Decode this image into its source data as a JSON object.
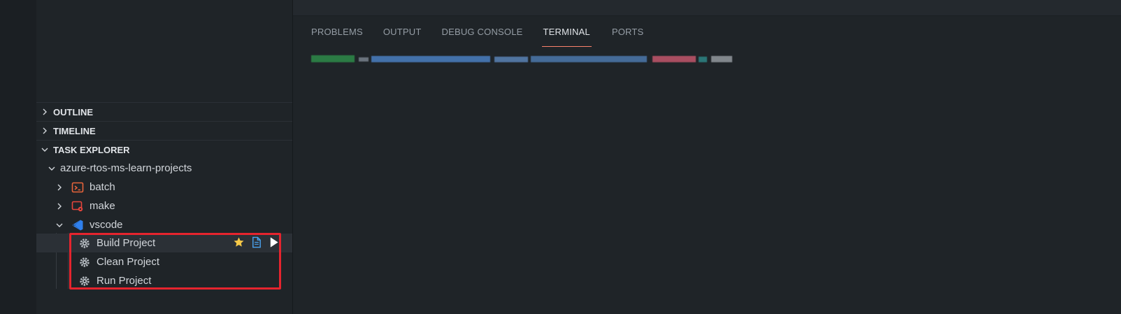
{
  "sidebar": {
    "sections": [
      {
        "label": "OUTLINE",
        "expanded": false
      },
      {
        "label": "TIMELINE",
        "expanded": false
      },
      {
        "label": "TASK EXPLORER",
        "expanded": true
      }
    ],
    "workspace": "azure-rtos-ms-learn-projects",
    "groups": [
      {
        "label": "batch",
        "icon": "terminal-icon",
        "expanded": false
      },
      {
        "label": "make",
        "icon": "make-gear-icon",
        "expanded": false
      },
      {
        "label": "vscode",
        "icon": "vscode-icon",
        "expanded": true
      }
    ],
    "tasks": [
      {
        "label": "Build Project",
        "selected": true
      },
      {
        "label": "Clean Project",
        "selected": false
      },
      {
        "label": "Run Project",
        "selected": false
      }
    ],
    "task_actions": [
      "star-icon",
      "open-file-icon",
      "run-icon"
    ]
  },
  "panel": {
    "tabs": [
      {
        "label": "PROBLEMS",
        "active": false
      },
      {
        "label": "OUTPUT",
        "active": false
      },
      {
        "label": "DEBUG CONSOLE",
        "active": false
      },
      {
        "label": "TERMINAL",
        "active": true
      },
      {
        "label": "PORTS",
        "active": false
      }
    ]
  },
  "colors": {
    "accent_tab": "#f9826c",
    "highlight_box": "#e5242e",
    "batch_icon": "#e8643b",
    "make_icon": "#e8453c",
    "vscode_icon": "#2f80ed"
  }
}
